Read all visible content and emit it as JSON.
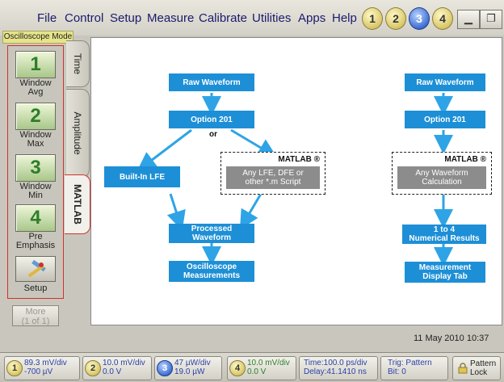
{
  "menu": {
    "items": [
      "File",
      "Control",
      "Setup",
      "Measure",
      "Calibrate",
      "Utilities",
      "Apps",
      "Help"
    ],
    "channels": [
      "1",
      "2",
      "3",
      "4"
    ],
    "active_channel": "3"
  },
  "mode_label": "Oscilloscope Mode",
  "left_panel": {
    "buttons": [
      {
        "number": "1",
        "label_line1": "Window",
        "label_line2": "Avg"
      },
      {
        "number": "2",
        "label_line1": "Window",
        "label_line2": "Max"
      },
      {
        "number": "3",
        "label_line1": "Window",
        "label_line2": "Min"
      },
      {
        "number": "4",
        "label_line1": "Pre",
        "label_line2": "Emphasis"
      }
    ],
    "setup_label": "Setup",
    "more_line1": "More",
    "more_line2": "(1 of 1)"
  },
  "tabs": {
    "time": "Time",
    "amplitude": "Amplitude",
    "matlab": "MATLAB"
  },
  "diagram": {
    "left_flow": {
      "raw_waveform": "Raw Waveform",
      "option": "Option 201",
      "or_label": "or",
      "builtin": "Built-In LFE",
      "matlab_title": "MATLAB ®",
      "matlab_body_line1": "Any LFE, DFE or",
      "matlab_body_line2": "other *.m Script",
      "processed_line1": "Processed",
      "processed_line2": "Waveform",
      "osc_line1": "Oscilloscope",
      "osc_line2": "Measurements"
    },
    "right_flow": {
      "raw_waveform": "Raw Waveform",
      "option": "Option 201",
      "matlab_title": "MATLAB ®",
      "matlab_body_line1": "Any Waveform",
      "matlab_body_line2": "Calculation",
      "results_line1": "1 to 4",
      "results_line2": "Numerical Results",
      "display_line1": "Measurement",
      "display_line2": "Display Tab"
    }
  },
  "datetime": "11 May 2010  10:37",
  "status_bar": {
    "channels": [
      {
        "num": "1",
        "line1": "89.3 mV/div",
        "line2": "-700 µV"
      },
      {
        "num": "2",
        "line1": "10.0 mV/div",
        "line2": "0.0 V"
      },
      {
        "num": "3",
        "line1": "47 µW/div",
        "line2": "19.0 µW"
      },
      {
        "num": "4",
        "line1": "10.0 mV/div",
        "line2": "0.0 V"
      }
    ],
    "time_line1": "Time:100.0 ps/div",
    "time_line2": "Delay:41.1410 ns",
    "trig_line1": "Trig: Pattern",
    "trig_line2": "Bit: 0",
    "pattern_line1": "Pattern",
    "pattern_line2": "Lock"
  },
  "colors": {
    "flow_box": "#1d8fd6",
    "matlab_box": "#8c8c8c",
    "highlight_border": "#d0312c",
    "active_channel": "#3f6fd4"
  }
}
